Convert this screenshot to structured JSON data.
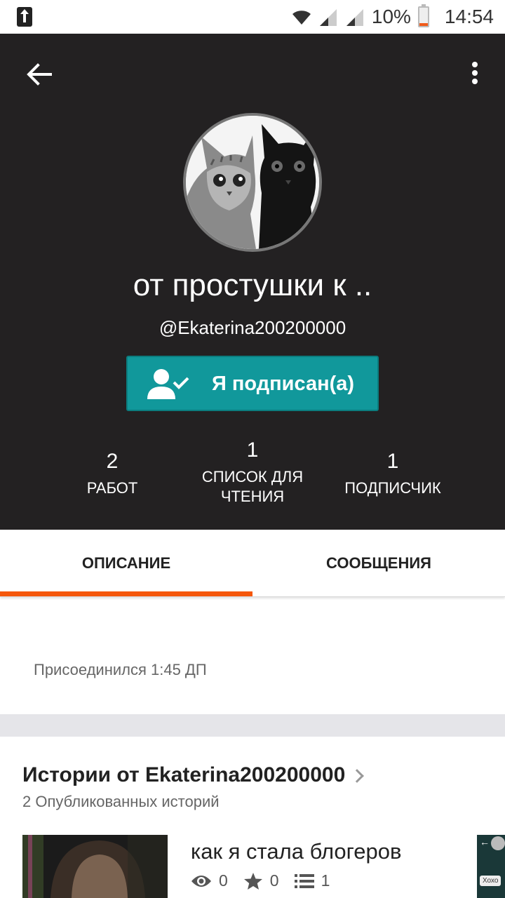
{
  "status_bar": {
    "battery": "10%",
    "time": "14:54"
  },
  "profile": {
    "display_name": "от простушки к ..",
    "username": "@Ekaterina200200000",
    "follow_button": "Я подписан(а)",
    "stats": [
      {
        "value": "2",
        "label": "РАБОТ"
      },
      {
        "value": "1",
        "label": "СПИСОК ДЛЯ ЧТЕНИЯ"
      },
      {
        "value": "1",
        "label": "ПОДПИСЧИК"
      }
    ]
  },
  "tabs": [
    {
      "label": "ОПИСАНИЕ",
      "active": true
    },
    {
      "label": "СООБЩЕНИЯ",
      "active": false
    }
  ],
  "about": {
    "joined": "Присоединился 1:45 ДП"
  },
  "stories": {
    "title": "Истории от Ekaterina200200000",
    "count": "2 Опубликованных историй",
    "items": [
      {
        "title": "как я стала блогеров",
        "views": "0",
        "votes": "0",
        "parts": "1"
      }
    ],
    "next_cover_text": "Хохо"
  },
  "colors": {
    "header_bg": "#232122",
    "follow_button": "#11989b",
    "tab_indicator": "#f5570b"
  },
  "icons": [
    "back-arrow-icon",
    "more-vert-icon",
    "person-check-icon",
    "chevron-right-icon",
    "eye-icon",
    "star-icon",
    "list-icon",
    "wifi-icon",
    "signal-icon",
    "battery-icon"
  ]
}
